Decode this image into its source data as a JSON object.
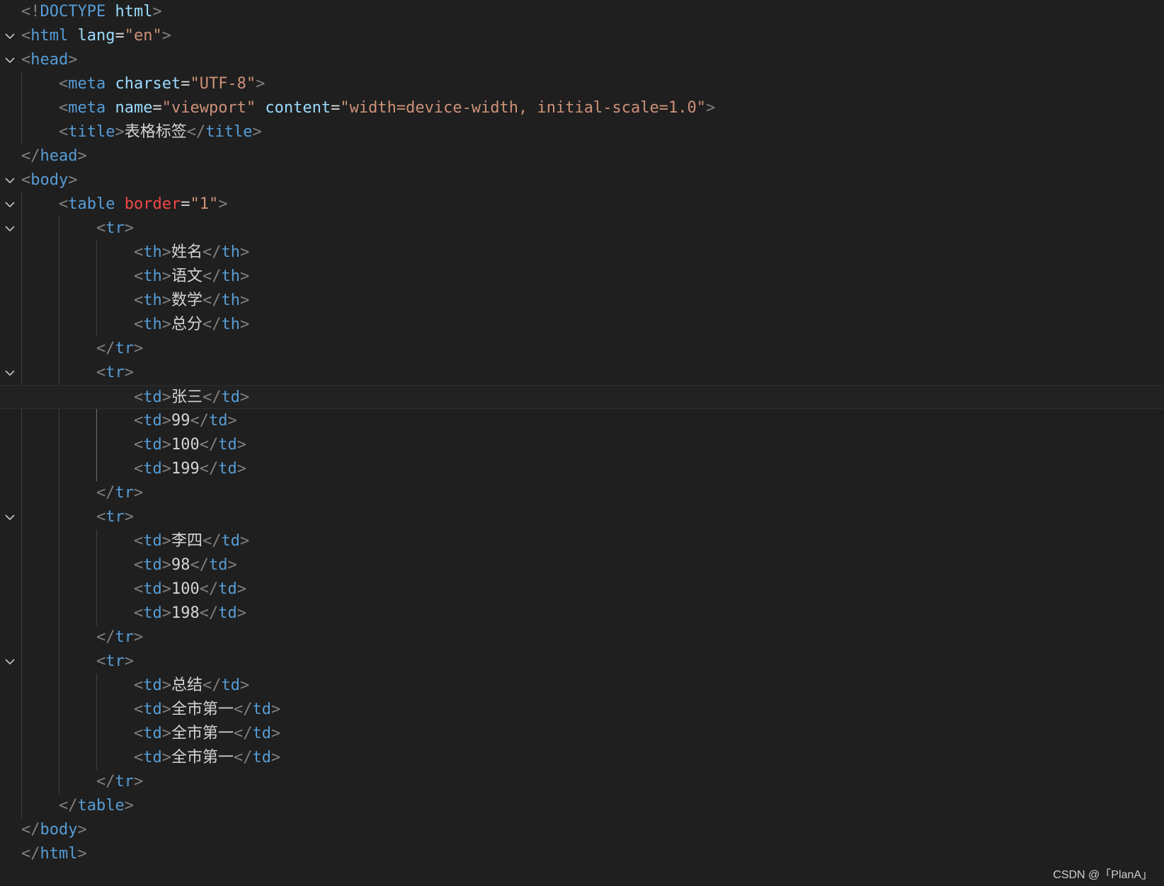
{
  "editor": {
    "theme_colors": {
      "background": "#1f1f1f",
      "tag_bracket": "#808080",
      "tag_name": "#569cd6",
      "attribute": "#9cdcfe",
      "attribute_error": "#f44747",
      "string": "#ce9178",
      "text": "#d4d4d4"
    },
    "lines": [
      {
        "indent": 0,
        "fold": false,
        "tokens": [
          [
            "t",
            "<!"
          ],
          [
            "n",
            "DOCTYPE"
          ],
          [
            "x",
            " "
          ],
          [
            "a",
            "html"
          ],
          [
            "t",
            ">"
          ]
        ]
      },
      {
        "indent": 0,
        "fold": true,
        "tokens": [
          [
            "t",
            "<"
          ],
          [
            "n",
            "html"
          ],
          [
            "x",
            " "
          ],
          [
            "a",
            "lang"
          ],
          [
            "x",
            "="
          ],
          [
            "v",
            "\"en\""
          ],
          [
            "t",
            ">"
          ]
        ]
      },
      {
        "indent": 0,
        "fold": true,
        "tokens": [
          [
            "t",
            "<"
          ],
          [
            "n",
            "head"
          ],
          [
            "t",
            ">"
          ]
        ]
      },
      {
        "indent": 1,
        "fold": false,
        "tokens": [
          [
            "t",
            "<"
          ],
          [
            "n",
            "meta"
          ],
          [
            "x",
            " "
          ],
          [
            "a",
            "charset"
          ],
          [
            "x",
            "="
          ],
          [
            "v",
            "\"UTF-8\""
          ],
          [
            "t",
            ">"
          ]
        ]
      },
      {
        "indent": 1,
        "fold": false,
        "tokens": [
          [
            "t",
            "<"
          ],
          [
            "n",
            "meta"
          ],
          [
            "x",
            " "
          ],
          [
            "a",
            "name"
          ],
          [
            "x",
            "="
          ],
          [
            "v",
            "\"viewport\""
          ],
          [
            "x",
            " "
          ],
          [
            "a",
            "content"
          ],
          [
            "x",
            "="
          ],
          [
            "v",
            "\"width=device-width, initial-scale=1.0\""
          ],
          [
            "t",
            ">"
          ]
        ]
      },
      {
        "indent": 1,
        "fold": false,
        "tokens": [
          [
            "t",
            "<"
          ],
          [
            "n",
            "title"
          ],
          [
            "t",
            ">"
          ],
          [
            "x",
            "表格标签"
          ],
          [
            "t",
            "</"
          ],
          [
            "n",
            "title"
          ],
          [
            "t",
            ">"
          ]
        ]
      },
      {
        "indent": 0,
        "fold": false,
        "tokens": [
          [
            "t",
            "</"
          ],
          [
            "n",
            "head"
          ],
          [
            "t",
            ">"
          ]
        ]
      },
      {
        "indent": 0,
        "fold": true,
        "tokens": [
          [
            "t",
            "<"
          ],
          [
            "n",
            "body"
          ],
          [
            "t",
            ">"
          ]
        ]
      },
      {
        "indent": 1,
        "fold": true,
        "tokens": [
          [
            "t",
            "<"
          ],
          [
            "n",
            "table"
          ],
          [
            "x",
            " "
          ],
          [
            "ar",
            "border"
          ],
          [
            "x",
            "="
          ],
          [
            "v",
            "\"1\""
          ],
          [
            "t",
            ">"
          ]
        ]
      },
      {
        "indent": 2,
        "fold": true,
        "tokens": [
          [
            "t",
            "<"
          ],
          [
            "n",
            "tr"
          ],
          [
            "t",
            ">"
          ]
        ]
      },
      {
        "indent": 3,
        "fold": false,
        "tokens": [
          [
            "t",
            "<"
          ],
          [
            "n",
            "th"
          ],
          [
            "t",
            ">"
          ],
          [
            "x",
            "姓名"
          ],
          [
            "t",
            "</"
          ],
          [
            "n",
            "th"
          ],
          [
            "t",
            ">"
          ]
        ]
      },
      {
        "indent": 3,
        "fold": false,
        "tokens": [
          [
            "t",
            "<"
          ],
          [
            "n",
            "th"
          ],
          [
            "t",
            ">"
          ],
          [
            "x",
            "语文"
          ],
          [
            "t",
            "</"
          ],
          [
            "n",
            "th"
          ],
          [
            "t",
            ">"
          ]
        ]
      },
      {
        "indent": 3,
        "fold": false,
        "tokens": [
          [
            "t",
            "<"
          ],
          [
            "n",
            "th"
          ],
          [
            "t",
            ">"
          ],
          [
            "x",
            "数学"
          ],
          [
            "t",
            "</"
          ],
          [
            "n",
            "th"
          ],
          [
            "t",
            ">"
          ]
        ]
      },
      {
        "indent": 3,
        "fold": false,
        "tokens": [
          [
            "t",
            "<"
          ],
          [
            "n",
            "th"
          ],
          [
            "t",
            ">"
          ],
          [
            "x",
            "总分"
          ],
          [
            "t",
            "</"
          ],
          [
            "n",
            "th"
          ],
          [
            "t",
            ">"
          ]
        ]
      },
      {
        "indent": 2,
        "fold": false,
        "tokens": [
          [
            "t",
            "</"
          ],
          [
            "n",
            "tr"
          ],
          [
            "t",
            ">"
          ]
        ]
      },
      {
        "indent": 2,
        "fold": true,
        "tokens": [
          [
            "t",
            "<"
          ],
          [
            "n",
            "tr"
          ],
          [
            "t",
            ">"
          ]
        ]
      },
      {
        "indent": 3,
        "fold": false,
        "current": true,
        "tokens": [
          [
            "t",
            "<"
          ],
          [
            "n",
            "td"
          ],
          [
            "t",
            ">"
          ],
          [
            "x",
            "张三"
          ],
          [
            "t",
            "</"
          ],
          [
            "n",
            "td"
          ],
          [
            "t",
            ">"
          ]
        ]
      },
      {
        "indent": 3,
        "fold": false,
        "tokens": [
          [
            "t",
            "<"
          ],
          [
            "n",
            "td"
          ],
          [
            "t",
            ">"
          ],
          [
            "x",
            "99"
          ],
          [
            "t",
            "</"
          ],
          [
            "n",
            "td"
          ],
          [
            "t",
            ">"
          ]
        ]
      },
      {
        "indent": 3,
        "fold": false,
        "tokens": [
          [
            "t",
            "<"
          ],
          [
            "n",
            "td"
          ],
          [
            "t",
            ">"
          ],
          [
            "x",
            "100"
          ],
          [
            "t",
            "</"
          ],
          [
            "n",
            "td"
          ],
          [
            "t",
            ">"
          ]
        ]
      },
      {
        "indent": 3,
        "fold": false,
        "tokens": [
          [
            "t",
            "<"
          ],
          [
            "n",
            "td"
          ],
          [
            "t",
            ">"
          ],
          [
            "x",
            "199"
          ],
          [
            "t",
            "</"
          ],
          [
            "n",
            "td"
          ],
          [
            "t",
            ">"
          ]
        ]
      },
      {
        "indent": 2,
        "fold": false,
        "tokens": [
          [
            "t",
            "</"
          ],
          [
            "n",
            "tr"
          ],
          [
            "t",
            ">"
          ]
        ]
      },
      {
        "indent": 2,
        "fold": true,
        "tokens": [
          [
            "t",
            "<"
          ],
          [
            "n",
            "tr"
          ],
          [
            "t",
            ">"
          ]
        ]
      },
      {
        "indent": 3,
        "fold": false,
        "tokens": [
          [
            "t",
            "<"
          ],
          [
            "n",
            "td"
          ],
          [
            "t",
            ">"
          ],
          [
            "x",
            "李四"
          ],
          [
            "t",
            "</"
          ],
          [
            "n",
            "td"
          ],
          [
            "t",
            ">"
          ]
        ]
      },
      {
        "indent": 3,
        "fold": false,
        "tokens": [
          [
            "t",
            "<"
          ],
          [
            "n",
            "td"
          ],
          [
            "t",
            ">"
          ],
          [
            "x",
            "98"
          ],
          [
            "t",
            "</"
          ],
          [
            "n",
            "td"
          ],
          [
            "t",
            ">"
          ]
        ]
      },
      {
        "indent": 3,
        "fold": false,
        "tokens": [
          [
            "t",
            "<"
          ],
          [
            "n",
            "td"
          ],
          [
            "t",
            ">"
          ],
          [
            "x",
            "100"
          ],
          [
            "t",
            "</"
          ],
          [
            "n",
            "td"
          ],
          [
            "t",
            ">"
          ]
        ]
      },
      {
        "indent": 3,
        "fold": false,
        "tokens": [
          [
            "t",
            "<"
          ],
          [
            "n",
            "td"
          ],
          [
            "t",
            ">"
          ],
          [
            "x",
            "198"
          ],
          [
            "t",
            "</"
          ],
          [
            "n",
            "td"
          ],
          [
            "t",
            ">"
          ]
        ]
      },
      {
        "indent": 2,
        "fold": false,
        "tokens": [
          [
            "t",
            "</"
          ],
          [
            "n",
            "tr"
          ],
          [
            "t",
            ">"
          ]
        ]
      },
      {
        "indent": 2,
        "fold": true,
        "tokens": [
          [
            "t",
            "<"
          ],
          [
            "n",
            "tr"
          ],
          [
            "t",
            ">"
          ]
        ]
      },
      {
        "indent": 3,
        "fold": false,
        "tokens": [
          [
            "t",
            "<"
          ],
          [
            "n",
            "td"
          ],
          [
            "t",
            ">"
          ],
          [
            "x",
            "总结"
          ],
          [
            "t",
            "</"
          ],
          [
            "n",
            "td"
          ],
          [
            "t",
            ">"
          ]
        ]
      },
      {
        "indent": 3,
        "fold": false,
        "tokens": [
          [
            "t",
            "<"
          ],
          [
            "n",
            "td"
          ],
          [
            "t",
            ">"
          ],
          [
            "x",
            "全市第一"
          ],
          [
            "t",
            "</"
          ],
          [
            "n",
            "td"
          ],
          [
            "t",
            ">"
          ]
        ]
      },
      {
        "indent": 3,
        "fold": false,
        "tokens": [
          [
            "t",
            "<"
          ],
          [
            "n",
            "td"
          ],
          [
            "t",
            ">"
          ],
          [
            "x",
            "全市第一"
          ],
          [
            "t",
            "</"
          ],
          [
            "n",
            "td"
          ],
          [
            "t",
            ">"
          ]
        ]
      },
      {
        "indent": 3,
        "fold": false,
        "tokens": [
          [
            "t",
            "<"
          ],
          [
            "n",
            "td"
          ],
          [
            "t",
            ">"
          ],
          [
            "x",
            "全市第一"
          ],
          [
            "t",
            "</"
          ],
          [
            "n",
            "td"
          ],
          [
            "t",
            ">"
          ]
        ]
      },
      {
        "indent": 2,
        "fold": false,
        "tokens": [
          [
            "t",
            "</"
          ],
          [
            "n",
            "tr"
          ],
          [
            "t",
            ">"
          ]
        ]
      },
      {
        "indent": 1,
        "fold": false,
        "tokens": [
          [
            "t",
            "</"
          ],
          [
            "n",
            "table"
          ],
          [
            "t",
            ">"
          ]
        ]
      },
      {
        "indent": 0,
        "fold": false,
        "tokens": [
          [
            "t",
            "</"
          ],
          [
            "n",
            "body"
          ],
          [
            "t",
            ">"
          ]
        ]
      },
      {
        "indent": 0,
        "fold": false,
        "tokens": [
          [
            "t",
            "</"
          ],
          [
            "n",
            "html"
          ],
          [
            "t",
            ">"
          ]
        ]
      }
    ]
  },
  "watermark": "CSDN @「PlanA」"
}
